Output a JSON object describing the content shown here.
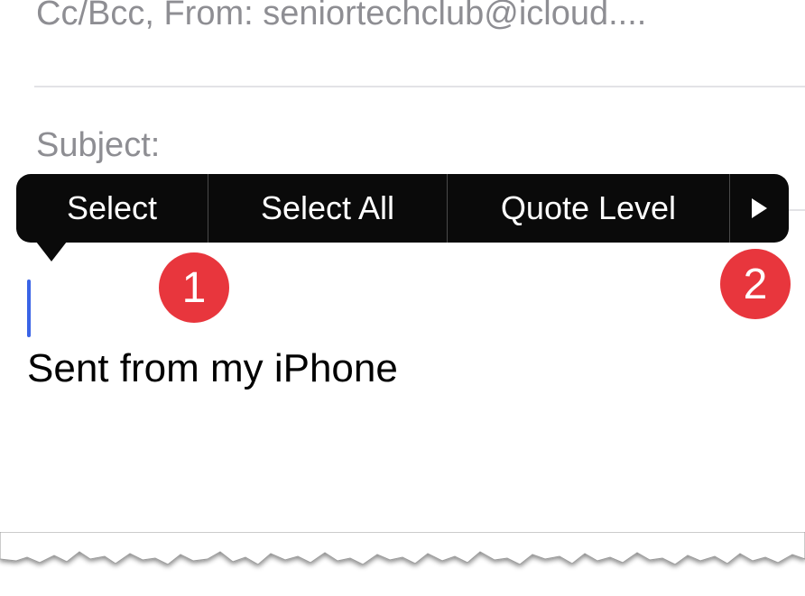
{
  "header": {
    "cc_line": "Cc/Bcc, From: seniortechclub@icloud...."
  },
  "subject": {
    "label": "Subject:"
  },
  "context_menu": {
    "items": [
      {
        "label": "Select"
      },
      {
        "label": "Select All"
      },
      {
        "label": "Quote Level"
      }
    ],
    "more_icon": "right-triangle"
  },
  "callouts": [
    {
      "label": "1"
    },
    {
      "label": "2"
    }
  ],
  "body": {
    "signature": "Sent from my iPhone"
  },
  "colors": {
    "menu_background": "#0a0a0a",
    "callout": "#e8363d",
    "cursor": "#3a64e6",
    "placeholder_text": "#8e8e93"
  }
}
